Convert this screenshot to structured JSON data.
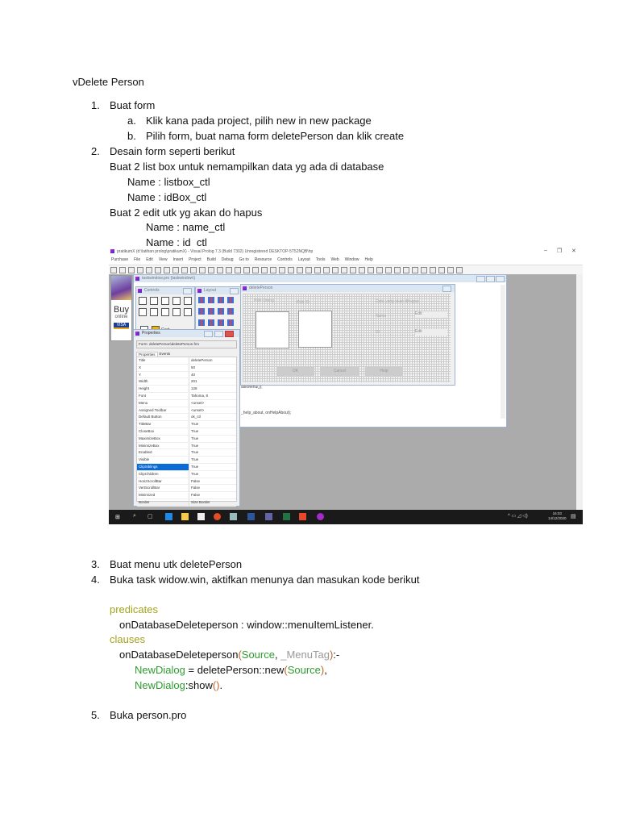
{
  "heading": "vDelete Person",
  "steps": [
    {
      "num": "1.",
      "text": "Buat form",
      "sub": [
        {
          "num": "a.",
          "text": "Klik kana pada project, pilih new in new package"
        },
        {
          "num": "b.",
          "text": "Pilih form, buat nama form deletePerson dan klik create"
        }
      ]
    },
    {
      "num": "2.",
      "text": "Desain form seperti berikut",
      "lines": [
        "Buat 2 list box untuk nemampilkan data yg ada di database",
        "Name : listbox_ctl",
        "Name : idBox_ctl",
        "Buat 2 edit utk yg akan do hapus",
        "Name : name_ctl",
        "Name : id_ctl"
      ]
    },
    {
      "num": "3.",
      "text": "Buat menu utk deletePerson"
    },
    {
      "num": "4.",
      "text": "Buka task widow.win, aktifkan menunya dan masukan kode berikut"
    },
    {
      "num": "5.",
      "text": "Buka person.pro"
    }
  ],
  "code": {
    "predicates": "predicates",
    "decl": "onDatabaseDeleteperson : window::menuItemListener.",
    "clauses": "clauses",
    "clause_name": "onDatabaseDeleteperson",
    "p_open": "(",
    "arg1": "Source",
    "comma": ", ",
    "arg2": "_MenuTag",
    "p_close": ")",
    "neck": ":-",
    "var1": "NewDialog",
    "assign": " = deletePerson::new",
    "arg3": "Source",
    "end1": ",",
    "var2": "NewDialog",
    "call": ":show",
    "parens": "()",
    "end2": "."
  },
  "screenshot": {
    "title": "pratikumX (d:\\latihan prolog\\pratikumX) - Visual Prolog 7.3 (Build 7302) Unregistered DESKTOP-5T52NQB\\hp",
    "menu": [
      "Purchase",
      "File",
      "Edit",
      "View",
      "Insert",
      "Project",
      "Build",
      "Debug",
      "Go to",
      "Resource",
      "Controls",
      "Layout",
      "Tools",
      "Web",
      "Window",
      "Help"
    ],
    "ad": {
      "buy": "Buy",
      "online": "online",
      "visa": "VISA"
    },
    "taskwindow_title": "taskwindow.pro (taskwindow\\)",
    "controls_title": "Controls",
    "controls_text": "Cust",
    "layout_title": "Layout",
    "dialog": {
      "title": "deletePerson",
      "group1": "Pilih Orang",
      "group2": "Pilih ID",
      "group3": "Data yang akan dihapus",
      "label_name": "Name",
      "label_id": "ID",
      "edit1": "Edit",
      "edit2": "Edit",
      "ok": "OK",
      "cancel": "Cancel",
      "help": "Help"
    },
    "code_line1": "askMenu());",
    "code_line2": "_help_about, onHelpAbout);",
    "properties": {
      "title": "Properties",
      "selector": "Form: deletePerson\\deletePerson.frm",
      "tabs": [
        "Properties",
        "Events"
      ],
      "rows": [
        [
          "Title",
          "deletePerson"
        ],
        [
          "X",
          "50"
        ],
        [
          "Y",
          "40"
        ],
        [
          "Width",
          "201"
        ],
        [
          "Height",
          "128"
        ],
        [
          "Font",
          "Tahoma, 8"
        ],
        [
          "Menu",
          "<unset>"
        ],
        [
          "Assigned Toolbar",
          "<unset>"
        ],
        [
          "Default Button",
          "ok_ctl"
        ],
        [
          "TitleBar",
          "True"
        ],
        [
          "CloseBox",
          "True"
        ],
        [
          "MaximizeBox",
          "True"
        ],
        [
          "MinimizeBox",
          "True"
        ],
        [
          "Enabled",
          "True"
        ],
        [
          "Visible",
          "True"
        ],
        [
          "ClipSiblings",
          "True"
        ],
        [
          "ClipChildren",
          "True"
        ],
        [
          "HorizScrollBar",
          "False"
        ],
        [
          "VertScrollBar",
          "False"
        ],
        [
          "Minimized",
          "False"
        ],
        [
          "Border",
          "Size Border"
        ]
      ],
      "selected_row": 15
    },
    "taskbar": {
      "time": "16:03",
      "date": "14/12/2020"
    }
  }
}
